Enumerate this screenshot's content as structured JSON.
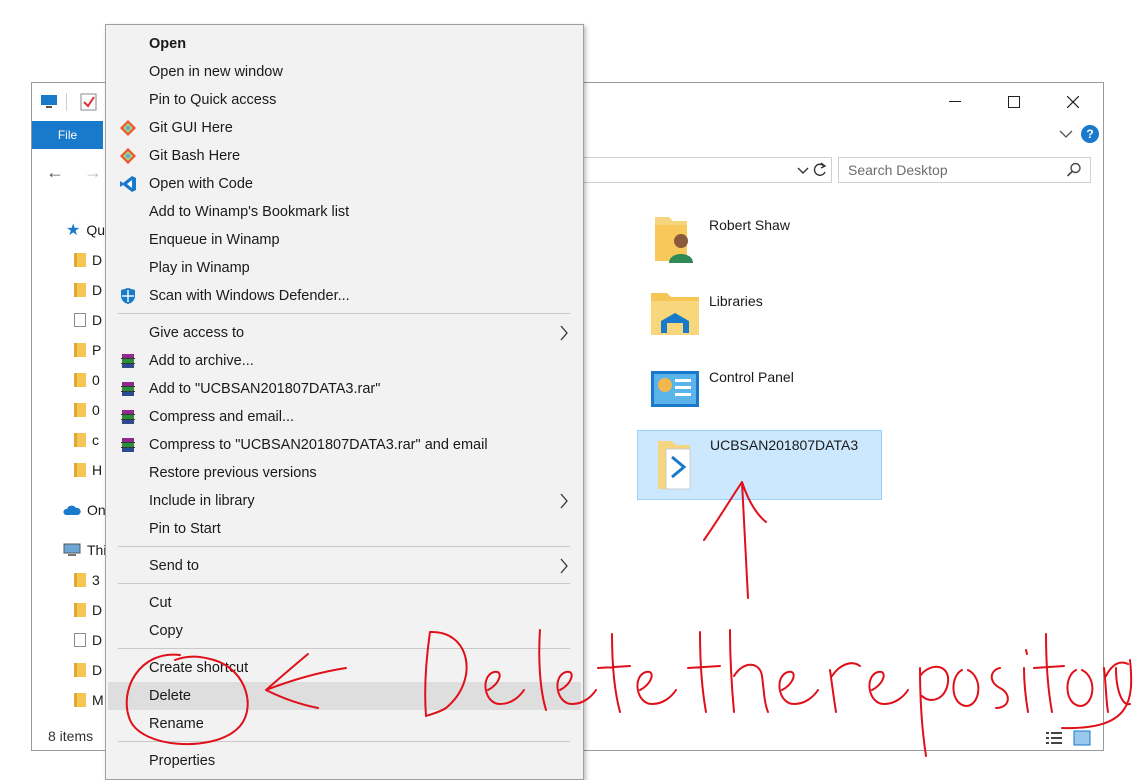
{
  "window": {
    "file_tab": "File",
    "search_placeholder": "Search Desktop",
    "status_text": "8 items"
  },
  "nav_pane": [
    {
      "label": "Qu",
      "icon": "star-icon"
    },
    {
      "label": "D",
      "icon": "downloads-folder-icon"
    },
    {
      "label": "D",
      "icon": "desktop-folder-icon"
    },
    {
      "label": "D",
      "icon": "documents-folder-icon"
    },
    {
      "label": "P",
      "icon": "pictures-folder-icon"
    },
    {
      "label": "0",
      "icon": "folder-icon"
    },
    {
      "label": "0",
      "icon": "folder-icon"
    },
    {
      "label": "c",
      "icon": "folder-icon"
    },
    {
      "label": "H",
      "icon": "folder-icon"
    },
    {
      "label": "On",
      "icon": "onedrive-cloud-icon"
    },
    {
      "label": "Thi",
      "icon": "this-pc-icon"
    },
    {
      "label": "3",
      "icon": "3d-objects-folder-icon"
    },
    {
      "label": "D",
      "icon": "desktop-folder-icon"
    },
    {
      "label": "D",
      "icon": "documents-folder-icon"
    },
    {
      "label": "D",
      "icon": "downloads-folder-icon"
    },
    {
      "label": "M",
      "icon": "music-folder-icon"
    }
  ],
  "items": [
    {
      "label": "Robert Shaw",
      "icon": "user-folder-icon"
    },
    {
      "label": "Libraries",
      "icon": "libraries-icon"
    },
    {
      "label": "Control Panel",
      "icon": "control-panel-icon"
    },
    {
      "label": "UCBSAN201807DATA3",
      "icon": "vscode-folder-icon",
      "selected": true
    }
  ],
  "context_menu": [
    {
      "label": "Open",
      "bold": true
    },
    {
      "label": "Open in new window"
    },
    {
      "label": "Pin to Quick access"
    },
    {
      "label": "Git GUI Here",
      "icon": "git-icon"
    },
    {
      "label": "Git Bash Here",
      "icon": "git-icon"
    },
    {
      "label": "Open with Code",
      "icon": "vscode-icon"
    },
    {
      "label": "Add to Winamp's Bookmark list"
    },
    {
      "label": "Enqueue in Winamp"
    },
    {
      "label": "Play in Winamp"
    },
    {
      "label": "Scan with Windows Defender...",
      "icon": "windows-defender-icon"
    },
    {
      "separator": true
    },
    {
      "label": "Give access to",
      "submenu": true
    },
    {
      "label": "Add to archive...",
      "icon": "winrar-icon"
    },
    {
      "label": "Add to \"UCBSAN201807DATA3.rar\"",
      "icon": "winrar-icon"
    },
    {
      "label": "Compress and email...",
      "icon": "winrar-icon"
    },
    {
      "label": "Compress to \"UCBSAN201807DATA3.rar\" and email",
      "icon": "winrar-icon"
    },
    {
      "label": "Restore previous versions"
    },
    {
      "label": "Include in library",
      "submenu": true
    },
    {
      "label": "Pin to Start"
    },
    {
      "separator": true
    },
    {
      "label": "Send to",
      "submenu": true
    },
    {
      "separator": true
    },
    {
      "label": "Cut"
    },
    {
      "label": "Copy"
    },
    {
      "separator": true
    },
    {
      "label": "Create shortcut"
    },
    {
      "label": "Delete",
      "highlighted": true
    },
    {
      "label": "Rename"
    },
    {
      "separator": true
    },
    {
      "label": "Properties"
    }
  ],
  "annotation": {
    "handwritten_text": "Delete the repository",
    "color": "#e0101a"
  }
}
